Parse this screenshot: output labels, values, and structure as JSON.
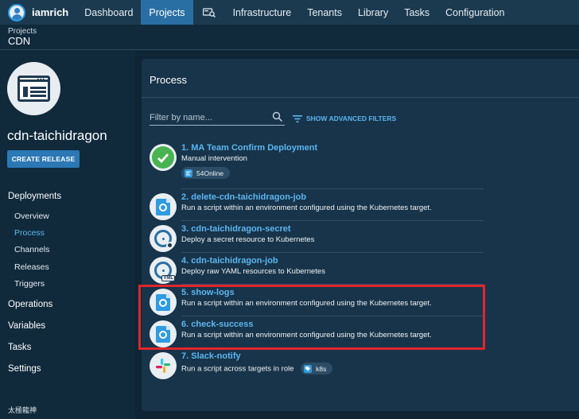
{
  "nav": {
    "user": "iamrich",
    "items": [
      "Dashboard",
      "Projects",
      "Infrastructure",
      "Tenants",
      "Library",
      "Tasks",
      "Configuration"
    ],
    "active": "Projects"
  },
  "breadcrumb": {
    "parent": "Projects",
    "current": "CDN"
  },
  "sidebar": {
    "project_name": "cdn-taichidragon",
    "create_release": "CREATE RELEASE",
    "deployments": "Deployments",
    "sub_items": [
      "Overview",
      "Process",
      "Channels",
      "Releases",
      "Triggers"
    ],
    "operations": "Operations",
    "variables": "Variables",
    "tasks": "Tasks",
    "settings": "Settings",
    "footer": "太極龍神"
  },
  "process": {
    "title": "Process",
    "filter_placeholder": "Filter by name...",
    "advanced_filters": "SHOW ADVANCED FILTERS",
    "steps": [
      {
        "number": "1.",
        "name": "MA Team Confirm Deployment",
        "desc": "Manual intervention",
        "chip": "54Online",
        "icon": "check-icon"
      },
      {
        "number": "2.",
        "name": "delete-cdn-taichidragon-job",
        "desc": "Run a script within an environment configured using the Kubernetes target.",
        "icon": "kubernetes-script-icon"
      },
      {
        "number": "3.",
        "name": "cdn-taichidragon-secret",
        "desc": "Deploy a secret resource to Kubernetes",
        "icon": "kubernetes-secret-icon"
      },
      {
        "number": "4.",
        "name": "cdn-taichidragon-job",
        "desc": "Deploy raw YAML resources to Kubernetes",
        "icon": "kubernetes-yaml-icon",
        "badge": "YML"
      },
      {
        "number": "5.",
        "name": "show-logs",
        "desc": "Run a script within an environment configured using the Kubernetes target.",
        "icon": "kubernetes-script-icon"
      },
      {
        "number": "6.",
        "name": "check-success",
        "desc": "Run a script within an environment configured using the Kubernetes target.",
        "icon": "kubernetes-script-icon"
      },
      {
        "number": "7.",
        "name": "Slack-notify",
        "desc": "Run a script across targets in role",
        "chip": "k8s",
        "icon": "slack-icon"
      }
    ]
  },
  "colors": {
    "accent": "#5bb6f0",
    "nav_active": "#2a6fa3",
    "highlight": "#e0262b",
    "success": "#48b350"
  }
}
